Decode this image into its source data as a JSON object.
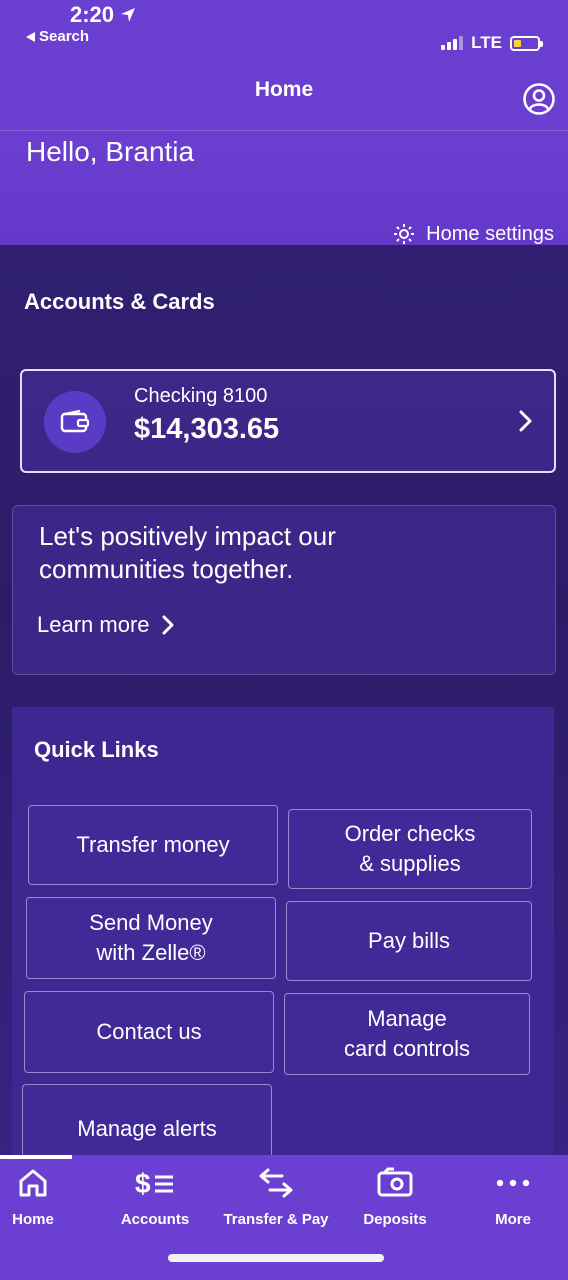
{
  "status_bar": {
    "time": "2:20",
    "back_label": "Search",
    "network": "LTE"
  },
  "header": {
    "title": "Home",
    "greeting": "Hello, Brantia",
    "home_settings_label": "Home settings"
  },
  "accounts": {
    "section_title": "Accounts & Cards",
    "items": [
      {
        "name": "Checking 8100",
        "balance": "$14,303.65"
      }
    ]
  },
  "promo": {
    "text": "Let's positively impact our communities together.",
    "link_label": "Learn more"
  },
  "quick_links": {
    "title": "Quick Links",
    "items": [
      {
        "label": "Transfer money"
      },
      {
        "label": "Order checks\n& supplies"
      },
      {
        "label": "Send Money\nwith Zelle®"
      },
      {
        "label": "Pay bills"
      },
      {
        "label": "Contact us"
      },
      {
        "label": "Manage\ncard controls"
      },
      {
        "label": "Manage alerts"
      }
    ]
  },
  "tab_bar": {
    "tabs": [
      {
        "label": "Home",
        "icon": "home-icon",
        "active": true
      },
      {
        "label": "Accounts",
        "icon": "accounts-icon"
      },
      {
        "label": "Transfer & Pay",
        "icon": "transfer-icon"
      },
      {
        "label": "Deposits",
        "icon": "deposit-icon"
      },
      {
        "label": "More",
        "icon": "more-icon"
      }
    ]
  },
  "colors": {
    "header_purple": "#6a3fd1",
    "background_dark": "#2e1f6e",
    "battery_yellow": "#f5d43a"
  }
}
